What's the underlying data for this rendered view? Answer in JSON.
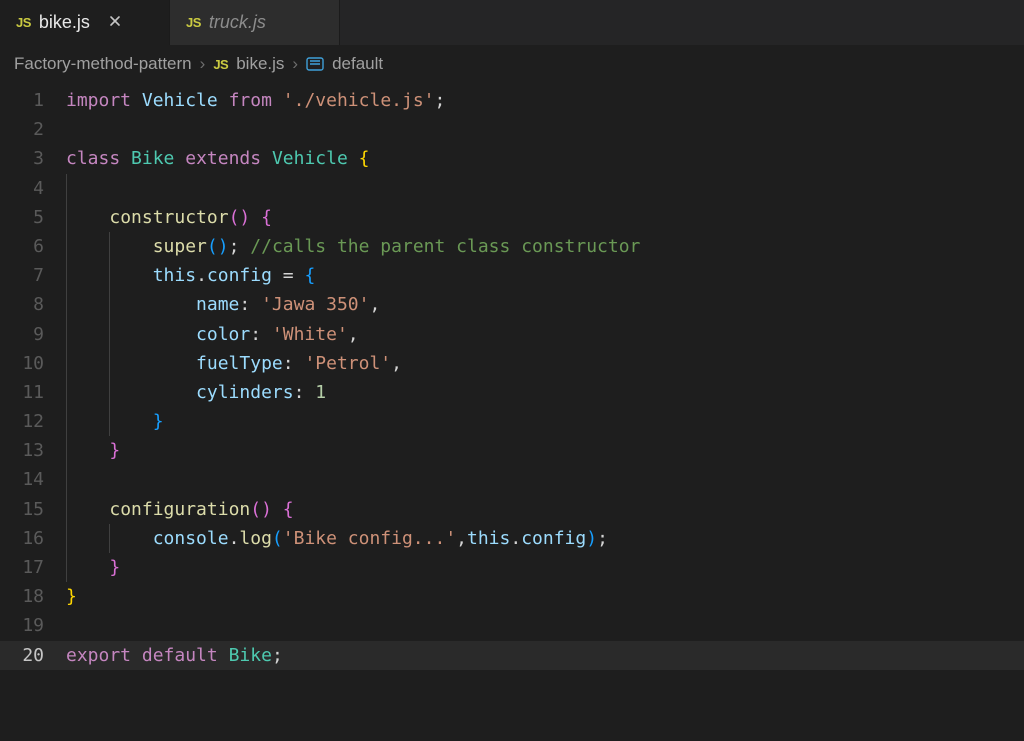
{
  "tabs": [
    {
      "icon": "JS",
      "label": "bike.js",
      "active": true,
      "closable": true
    },
    {
      "icon": "JS",
      "label": "truck.js",
      "active": false,
      "closable": false
    }
  ],
  "breadcrumbs": {
    "segments": [
      "Factory-method-pattern",
      "bike.js",
      "default"
    ],
    "file_icon": "JS",
    "symbol_icon": "symbol-module"
  },
  "editor": {
    "active_line": 20,
    "lines": [
      {
        "n": 1,
        "guides": [],
        "tokens": [
          [
            "k",
            "import"
          ],
          [
            "p",
            " "
          ],
          [
            "vb",
            "Vehicle"
          ],
          [
            "p",
            " "
          ],
          [
            "k",
            "from"
          ],
          [
            "p",
            " "
          ],
          [
            "s",
            "'./vehicle.js'"
          ],
          [
            "p",
            ";"
          ]
        ]
      },
      {
        "n": 2,
        "guides": [],
        "tokens": []
      },
      {
        "n": 3,
        "guides": [],
        "tokens": [
          [
            "k",
            "class"
          ],
          [
            "p",
            " "
          ],
          [
            "ty",
            "Bike"
          ],
          [
            "p",
            " "
          ],
          [
            "k",
            "extends"
          ],
          [
            "p",
            " "
          ],
          [
            "ty",
            "Vehicle"
          ],
          [
            "p",
            " "
          ],
          [
            "br-y",
            "{"
          ]
        ]
      },
      {
        "n": 4,
        "guides": [
          0
        ],
        "tokens": []
      },
      {
        "n": 5,
        "guides": [
          0
        ],
        "tokens": [
          [
            "p",
            "    "
          ],
          [
            "fn",
            "constructor"
          ],
          [
            "br-m",
            "()"
          ],
          [
            "p",
            " "
          ],
          [
            "br-m",
            "{"
          ]
        ]
      },
      {
        "n": 6,
        "guides": [
          0,
          4
        ],
        "tokens": [
          [
            "p",
            "        "
          ],
          [
            "fn",
            "super"
          ],
          [
            "br-b",
            "()"
          ],
          [
            "p",
            ";"
          ],
          [
            "p",
            " "
          ],
          [
            "cm",
            "//calls the parent class constructor"
          ]
        ]
      },
      {
        "n": 7,
        "guides": [
          0,
          4
        ],
        "tokens": [
          [
            "p",
            "        "
          ],
          [
            "vb",
            "this"
          ],
          [
            "p",
            "."
          ],
          [
            "va",
            "config"
          ],
          [
            "p",
            " = "
          ],
          [
            "br-b",
            "{"
          ]
        ]
      },
      {
        "n": 8,
        "guides": [
          0,
          4
        ],
        "tokens": [
          [
            "p",
            "            "
          ],
          [
            "va",
            "name"
          ],
          [
            "p",
            ": "
          ],
          [
            "s",
            "'Jawa 350'"
          ],
          [
            "p",
            ","
          ]
        ]
      },
      {
        "n": 9,
        "guides": [
          0,
          4
        ],
        "tokens": [
          [
            "p",
            "            "
          ],
          [
            "va",
            "color"
          ],
          [
            "p",
            ": "
          ],
          [
            "s",
            "'White'"
          ],
          [
            "p",
            ","
          ]
        ]
      },
      {
        "n": 10,
        "guides": [
          0,
          4
        ],
        "tokens": [
          [
            "p",
            "            "
          ],
          [
            "va",
            "fuelType"
          ],
          [
            "p",
            ": "
          ],
          [
            "s",
            "'Petrol'"
          ],
          [
            "p",
            ","
          ]
        ]
      },
      {
        "n": 11,
        "guides": [
          0,
          4
        ],
        "tokens": [
          [
            "p",
            "            "
          ],
          [
            "va",
            "cylinders"
          ],
          [
            "p",
            ": "
          ],
          [
            "n",
            "1"
          ]
        ]
      },
      {
        "n": 12,
        "guides": [
          0,
          4
        ],
        "tokens": [
          [
            "p",
            "        "
          ],
          [
            "br-b",
            "}"
          ]
        ]
      },
      {
        "n": 13,
        "guides": [
          0
        ],
        "tokens": [
          [
            "p",
            "    "
          ],
          [
            "br-m",
            "}"
          ]
        ]
      },
      {
        "n": 14,
        "guides": [
          0
        ],
        "tokens": []
      },
      {
        "n": 15,
        "guides": [
          0
        ],
        "tokens": [
          [
            "p",
            "    "
          ],
          [
            "fn",
            "configuration"
          ],
          [
            "br-m",
            "()"
          ],
          [
            "p",
            " "
          ],
          [
            "br-m",
            "{"
          ]
        ]
      },
      {
        "n": 16,
        "guides": [
          0,
          4
        ],
        "tokens": [
          [
            "p",
            "        "
          ],
          [
            "va",
            "console"
          ],
          [
            "p",
            "."
          ],
          [
            "fn",
            "log"
          ],
          [
            "br-b",
            "("
          ],
          [
            "s",
            "'Bike config...'"
          ],
          [
            "p",
            ","
          ],
          [
            "vb",
            "this"
          ],
          [
            "p",
            "."
          ],
          [
            "va",
            "config"
          ],
          [
            "br-b",
            ")"
          ],
          [
            "p",
            ";"
          ]
        ]
      },
      {
        "n": 17,
        "guides": [
          0
        ],
        "tokens": [
          [
            "p",
            "    "
          ],
          [
            "br-m",
            "}"
          ]
        ]
      },
      {
        "n": 18,
        "guides": [],
        "tokens": [
          [
            "br-y",
            "}"
          ]
        ]
      },
      {
        "n": 19,
        "guides": [],
        "tokens": []
      },
      {
        "n": 20,
        "guides": [],
        "tokens": [
          [
            "k",
            "export"
          ],
          [
            "p",
            " "
          ],
          [
            "k",
            "default"
          ],
          [
            "p",
            " "
          ],
          [
            "ty",
            "Bike"
          ],
          [
            "p",
            ";"
          ]
        ]
      }
    ]
  }
}
